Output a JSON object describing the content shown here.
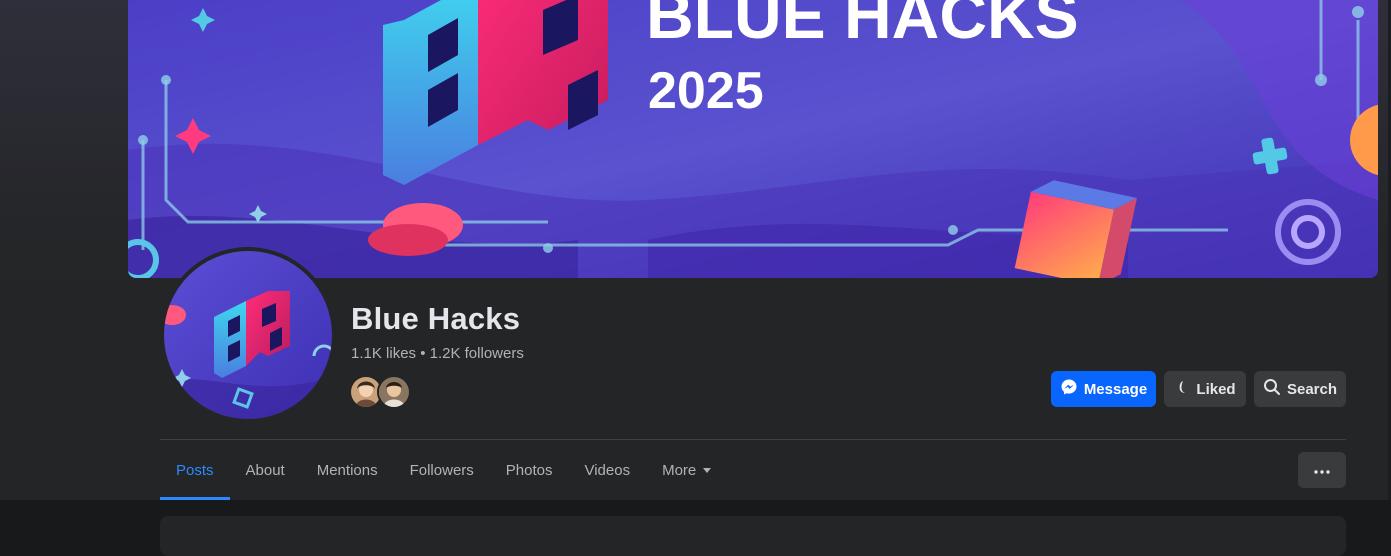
{
  "cover": {
    "title_line1": "BLUE HACKS",
    "title_line2": "2025"
  },
  "profile": {
    "name": "Blue Hacks",
    "stats": "1.1K likes • 1.2K followers"
  },
  "actions": {
    "message_label": "Message",
    "liked_label": "Liked",
    "search_label": "Search"
  },
  "tabs": [
    {
      "label": "Posts",
      "active": true
    },
    {
      "label": "About"
    },
    {
      "label": "Mentions"
    },
    {
      "label": "Followers"
    },
    {
      "label": "Photos"
    },
    {
      "label": "Videos"
    },
    {
      "label": "More"
    }
  ],
  "colors": {
    "accent": "#0866ff",
    "active_tab": "#2d88ff",
    "cover_purple": "#5b4fd6",
    "logo_pink": "#e8336f",
    "logo_cyan": "#35c6e8"
  },
  "icons": {
    "message": "messenger-icon",
    "liked": "thumbs-up-icon",
    "search": "search-icon",
    "more_tab": "caret-down-icon",
    "overflow": "ellipsis-icon"
  }
}
